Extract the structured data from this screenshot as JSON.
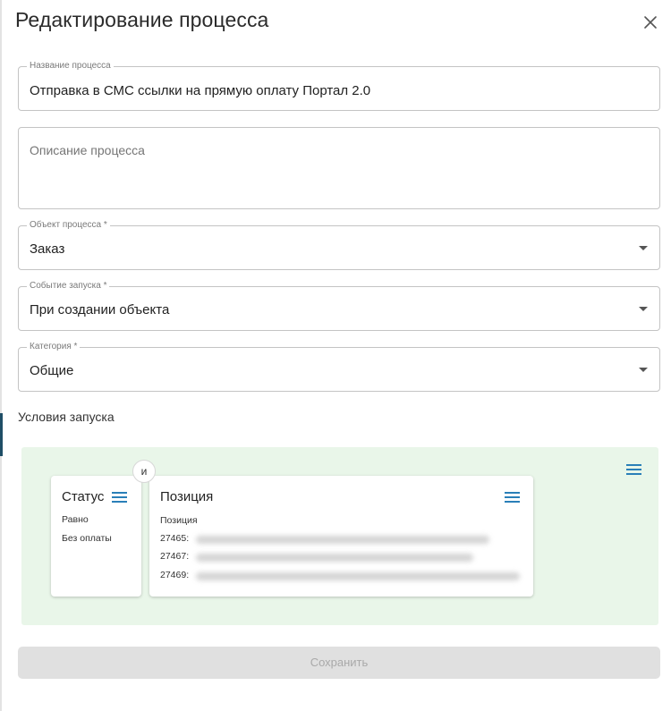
{
  "dialog": {
    "title": "Редактирование процесса"
  },
  "form": {
    "name": {
      "label": "Название процесса",
      "value": "Отправка в СМС ссылки на прямую оплату Портал 2.0"
    },
    "description": {
      "placeholder": "Описание процесса",
      "value": ""
    },
    "object": {
      "label": "Объект процесса *",
      "value": "Заказ"
    },
    "event": {
      "label": "Событие запуска *",
      "value": "При создании объекта"
    },
    "category": {
      "label": "Категория *",
      "value": "Общие"
    }
  },
  "conditions": {
    "label": "Условия запуска",
    "operator": "и",
    "status_card": {
      "title": "Статус",
      "comparison": "Равно",
      "value": "Без оплаты"
    },
    "position_card": {
      "title": "Позиция",
      "subtitle": "Позиция",
      "items": [
        "27465:",
        "27467:",
        "27469:"
      ]
    }
  },
  "actions": {
    "save_label": "Сохранить"
  },
  "colors": {
    "accent": "#2a7fb8",
    "conditions_bg": "#e9f6e9",
    "save_disabled_bg": "#e0e0e0"
  },
  "icons": {
    "close": "close-icon",
    "menu": "menu-icon",
    "dropdown": "chevron-down-icon"
  }
}
